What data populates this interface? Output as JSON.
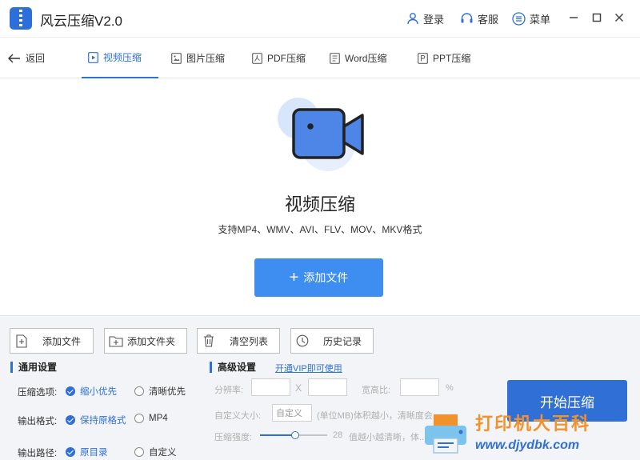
{
  "app": {
    "title": "风云压缩V2.0",
    "login": "登录",
    "service": "客服",
    "menu": "菜单"
  },
  "nav": {
    "back": "返回",
    "tabs": [
      {
        "label": "视频压缩",
        "active": true
      },
      {
        "label": "图片压缩",
        "active": false
      },
      {
        "label": "PDF压缩",
        "active": false
      },
      {
        "label": "Word压缩",
        "active": false
      },
      {
        "label": "PPT压缩",
        "active": false
      }
    ]
  },
  "hero": {
    "title": "视频压缩",
    "subtitle": "支持MP4、WMV、AVI、FLV、MOV、MKV格式",
    "add_button": "添加文件",
    "add_icon": "+"
  },
  "toolbar": {
    "add_file": "添加文件",
    "add_folder": "添加文件夹",
    "clear_list": "清空列表",
    "history": "历史记录"
  },
  "general": {
    "title": "通用设置",
    "compress_option_label": "压缩选项:",
    "compress_options": [
      "缩小优先",
      "清晰优先"
    ],
    "output_format_label": "输出格式:",
    "output_formats": [
      "保持原格式",
      "MP4"
    ],
    "output_path_label": "输出路径:",
    "output_paths": [
      "原目录",
      "自定义"
    ]
  },
  "advanced": {
    "title": "高级设置",
    "vip_link": "开通VIP即可使用",
    "resolution_label": "分辨率:",
    "x_sep": "X",
    "aspect_label": "宽高比:",
    "percent": "%",
    "custom_size_label": "自定义大小:",
    "custom_size_value": "自定义",
    "custom_size_note": "(单位MB)体积越小，清晰度会...",
    "strength_label": "压缩强度:",
    "strength_value": "28",
    "strength_note": "值越小越清晰，体...",
    "strength_fraction": 0.52
  },
  "start_button": "开始压缩",
  "watermark": {
    "line1": "打印机大百科",
    "line2": "www.djydbk.com"
  },
  "colors": {
    "primary": "#2f6fd6",
    "button_blue": "#3d8ef0",
    "watermark_orange": "#f2922c"
  }
}
